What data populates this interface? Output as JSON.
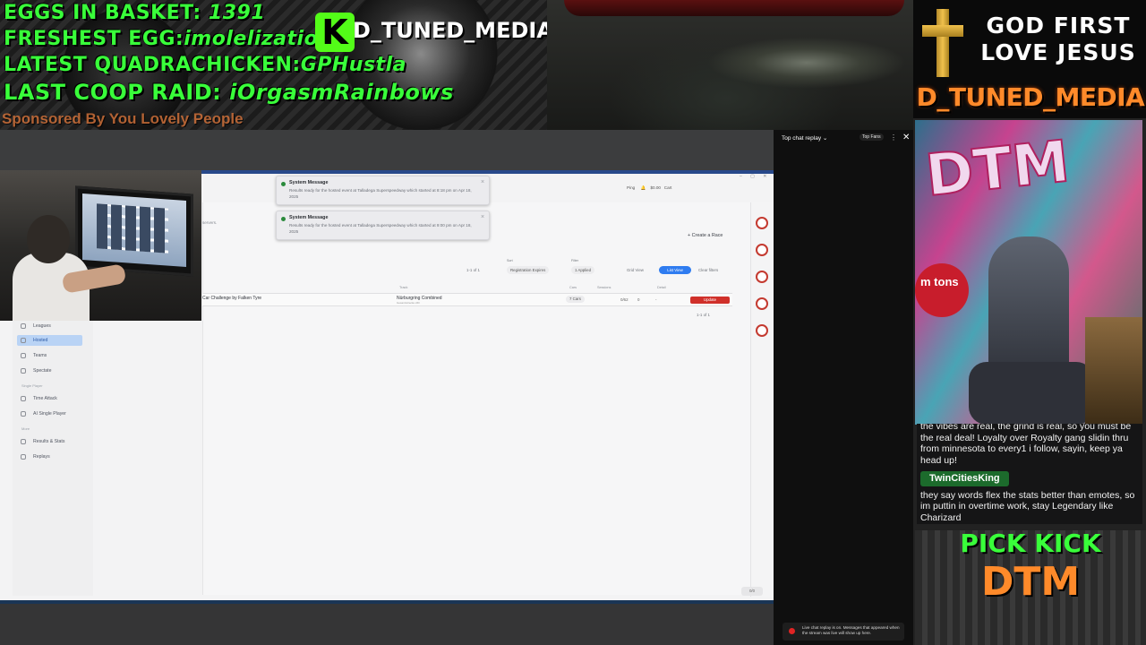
{
  "overlay_topleft": {
    "eggs_label": "EGGS IN BASKET:",
    "eggs_value": "1391",
    "freshest_label": "FRESHEST EGG:",
    "freshest_value": "imolelizationn",
    "quadra_label": "LATEST QUADRACHICKEN:",
    "quadra_value": "GPHustla",
    "coop_label": "LAST COOP RAID:",
    "coop_value": "iOrgasmRainbows",
    "sponsor": "Sponsored By You Lovely People",
    "kick_logo": "K",
    "brand": "D_TUNED_MEDIA"
  },
  "overlay_right": {
    "god_line1": "GOD FIRST",
    "god_line2": "LOVE JESUS",
    "brand": "D_TUNED_MEDIA",
    "room_sign": "m tons",
    "room_art": "DTM"
  },
  "chat_overlay": {
    "message1": "the vibes are real, the grind is real, so you must be the real deal! Loyalty over Royalty gang slidin thru from minnesota to every1 i follow, sayin, keep ya head up!",
    "username": "TwinCitiesKing",
    "message2": "they say words flex the stats better than emotes, so im puttin in overtime work, stay Legendary like Charizard"
  },
  "kick_panel": {
    "line1": "PICK KICK",
    "line2": "DTM"
  },
  "chat_replay": {
    "title": "Top chat replay",
    "chevron": "⌄",
    "top_fans": "Top Fans",
    "menu": "⋮",
    "close": "✕",
    "note": "Live chat replay is on. Messages that appeared when the stream was live will show up here."
  },
  "app": {
    "toasts": [
      {
        "title": "System Message",
        "body": "Results ready for the hosted event at Talladega Superspeedway which started at 8:18 pm on Apr 18, 2025",
        "close": "×"
      },
      {
        "title": "System Message",
        "body": "Results ready for the hosted event at Talladega Superspeedway which started at 9:00 pm on Apr 18, 2025",
        "close": "×"
      }
    ],
    "header": {
      "ping": "Ping",
      "balance": "$0.00",
      "cart": "Cart",
      "window_controls": "– ▢ ✕"
    },
    "servers_text": "servers.",
    "create_race": "+ Create a Race",
    "toolbar": {
      "count": "1-1 of 1",
      "sort_label": "Sort",
      "sort_value": "Registration Expires",
      "filter_label": "Filter",
      "filter_value": "1 Applied",
      "grid_view": "Grid View",
      "list_view": "List View",
      "clear_filters": "Clear filters"
    },
    "table_headers": {
      "track": "Track",
      "cars": "Cars",
      "sessions": "Sessions",
      "detail": "Detail"
    },
    "row": {
      "name": "Car Challenge by Falken Tyre",
      "track": "Nürburgring Combined",
      "track_sub": "Gesamtstrecke 24h",
      "cars": "7 Cars",
      "drivers": "0/62",
      "zero": "0",
      "dash": "-",
      "action": "Update"
    },
    "pager_bottom": "1-1 of 1",
    "sidebar": {
      "leagues": "Leagues",
      "hosted": "Hosted",
      "teams": "Teams",
      "spectate": "Spectate",
      "single_player_section": "Single Player",
      "time_attack": "Time Attack",
      "ai_single_player": "AI Single Player",
      "more_section": "More",
      "results_stats": "Results & Stats",
      "replays": "Replays"
    },
    "footer_badge": "0/0"
  },
  "colors": {
    "overlay_green": "#39ff3a",
    "brand_orange": "#ff8a2a",
    "accent_blue": "#2f7cf0",
    "update_red": "#d0302a"
  }
}
